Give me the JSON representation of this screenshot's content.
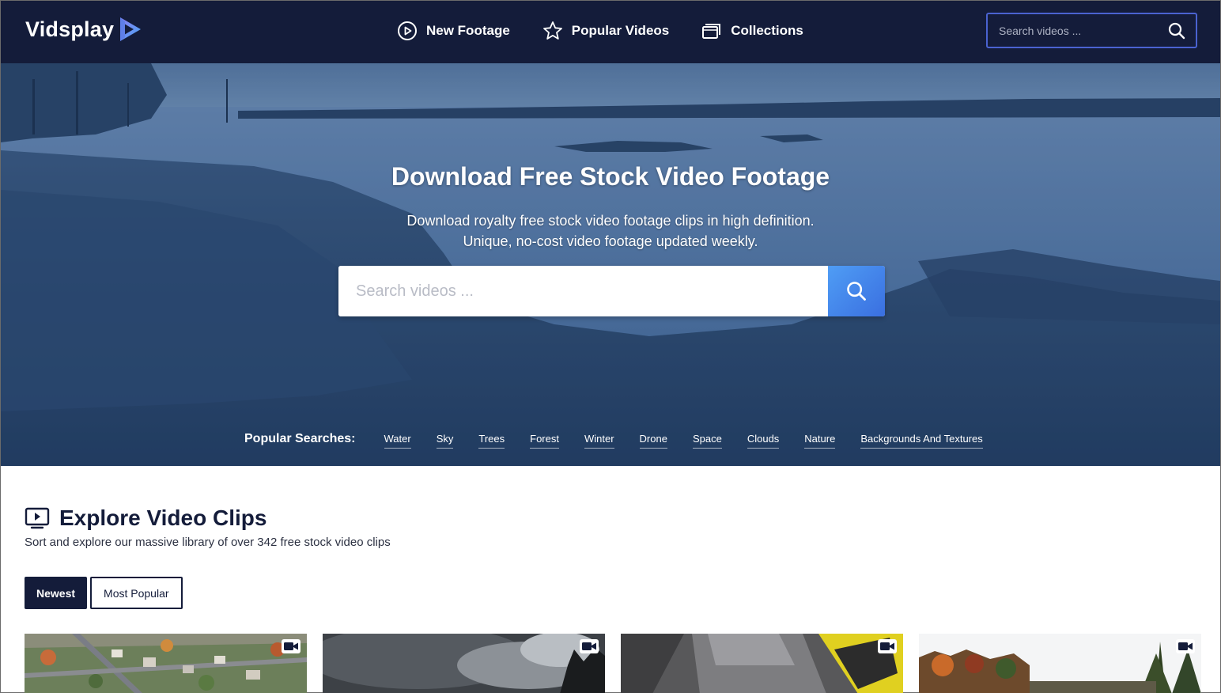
{
  "brand": {
    "name": "Vidsplay"
  },
  "nav": {
    "items": [
      {
        "label": "New Footage",
        "icon": "play-circle-icon"
      },
      {
        "label": "Popular Videos",
        "icon": "star-icon"
      },
      {
        "label": "Collections",
        "icon": "collections-icon"
      }
    ],
    "search_placeholder": "Search videos ..."
  },
  "hero": {
    "title": "Download Free Stock Video Footage",
    "subtitle_line1": "Download royalty free stock video footage clips in high definition.",
    "subtitle_line2": "Unique, no-cost video footage updated weekly.",
    "search_placeholder": "Search videos ...",
    "popular_label": "Popular Searches:",
    "popular_tags": [
      "Water",
      "Sky",
      "Trees",
      "Forest",
      "Winter",
      "Drone",
      "Space",
      "Clouds",
      "Nature",
      "Backgrounds And Textures"
    ]
  },
  "explore": {
    "title": "Explore Video Clips",
    "subtitle": "Sort and explore our massive library of over 342 free stock video clips",
    "sort_options": [
      "Newest",
      "Most Popular"
    ],
    "active_sort": "Newest"
  },
  "thumbnails": [
    {
      "subject": "aerial-neighborhood"
    },
    {
      "subject": "storm-clouds"
    },
    {
      "subject": "machinery"
    },
    {
      "subject": "autumn-trees"
    }
  ],
  "colors": {
    "navbar_bg": "#141c3a",
    "accent_blue": "#4a62d0",
    "search_button": "#4f9df5",
    "white": "#ffffff"
  }
}
